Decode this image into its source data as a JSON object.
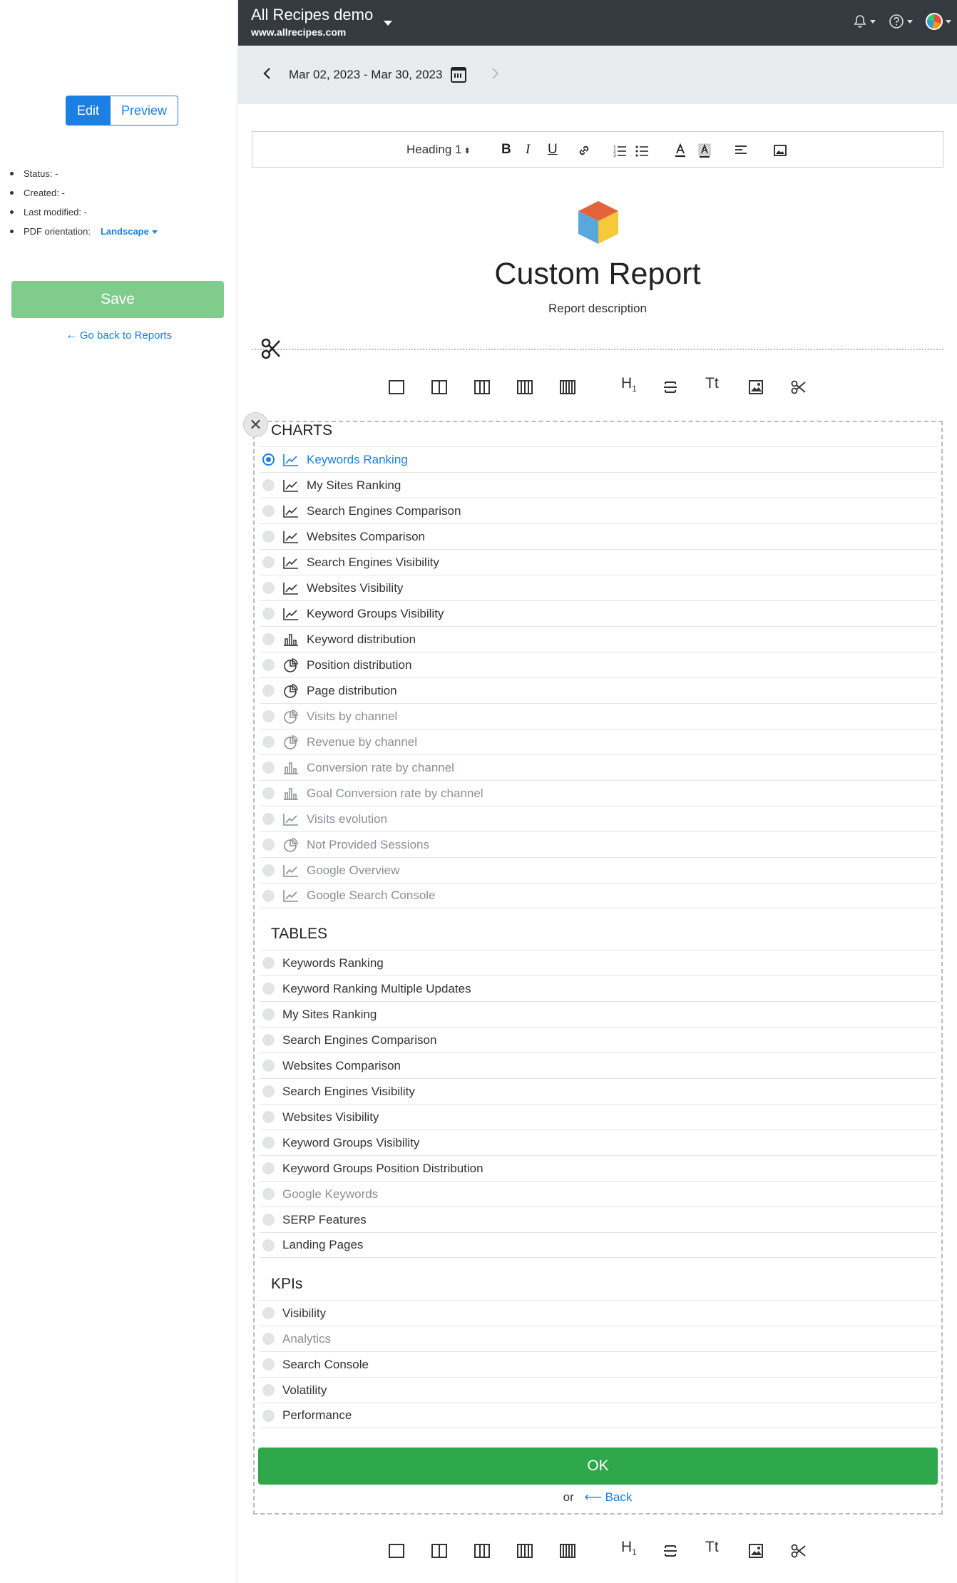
{
  "sidebar": {
    "mode_edit": "Edit",
    "mode_preview": "Preview",
    "status_label": "Status:",
    "status_value": "-",
    "created_label": "Created:",
    "created_value": "-",
    "modified_label": "Last modified:",
    "modified_value": "-",
    "orientation_label": "PDF orientation:",
    "orientation_value": "Landscape",
    "save_label": "Save",
    "back_label": "Go back to Reports"
  },
  "topbar": {
    "title": "All Recipes demo",
    "subtitle": "www.allrecipes.com",
    "icons": [
      "bell-icon",
      "help-icon",
      "avatar"
    ]
  },
  "datebar": {
    "range": "Mar 02, 2023 - Mar 30, 2023"
  },
  "editor_toolbar": {
    "heading": "Heading 1"
  },
  "report": {
    "title": "Custom Report",
    "description": "Report description"
  },
  "block_bar": {
    "heading_glyph": "H",
    "heading_sub": "1",
    "text_glyph": "Tt"
  },
  "panel": {
    "charts_title": "CHARTS",
    "charts": [
      {
        "label": "Keywords Ranking",
        "icon": "line",
        "state": "selected"
      },
      {
        "label": "My Sites Ranking",
        "icon": "line",
        "state": "normal"
      },
      {
        "label": "Search Engines Comparison",
        "icon": "line",
        "state": "normal"
      },
      {
        "label": "Websites Comparison",
        "icon": "line",
        "state": "normal"
      },
      {
        "label": "Search Engines Visibility",
        "icon": "line",
        "state": "normal"
      },
      {
        "label": "Websites Visibility",
        "icon": "line",
        "state": "normal"
      },
      {
        "label": "Keyword Groups Visibility",
        "icon": "line",
        "state": "normal"
      },
      {
        "label": "Keyword distribution",
        "icon": "bar",
        "state": "normal"
      },
      {
        "label": "Position distribution",
        "icon": "pie",
        "state": "normal"
      },
      {
        "label": "Page distribution",
        "icon": "pie",
        "state": "normal"
      },
      {
        "label": "Visits by channel",
        "icon": "pie",
        "state": "disabled"
      },
      {
        "label": "Revenue by channel",
        "icon": "pie",
        "state": "disabled"
      },
      {
        "label": "Conversion rate by channel",
        "icon": "bar",
        "state": "disabled"
      },
      {
        "label": "Goal Conversion rate by channel",
        "icon": "bar",
        "state": "disabled"
      },
      {
        "label": "Visits evolution",
        "icon": "line",
        "state": "disabled"
      },
      {
        "label": "Not Provided Sessions",
        "icon": "pie",
        "state": "disabled"
      },
      {
        "label": "Google Overview",
        "icon": "line",
        "state": "disabled"
      },
      {
        "label": "Google Search Console",
        "icon": "line",
        "state": "disabled"
      }
    ],
    "tables_title": "TABLES",
    "tables": [
      {
        "label": "Keywords Ranking",
        "state": "normal"
      },
      {
        "label": "Keyword Ranking Multiple Updates",
        "state": "normal"
      },
      {
        "label": "My Sites Ranking",
        "state": "normal"
      },
      {
        "label": "Search Engines Comparison",
        "state": "normal"
      },
      {
        "label": "Websites Comparison",
        "state": "normal"
      },
      {
        "label": "Search Engines Visibility",
        "state": "normal"
      },
      {
        "label": "Websites Visibility",
        "state": "normal"
      },
      {
        "label": "Keyword Groups Visibility",
        "state": "normal"
      },
      {
        "label": "Keyword Groups Position Distribution",
        "state": "normal"
      },
      {
        "label": "Google Keywords",
        "state": "disabled"
      },
      {
        "label": "SERP Features",
        "state": "normal"
      },
      {
        "label": "Landing Pages",
        "state": "normal"
      }
    ],
    "kpis_title": "KPIs",
    "kpis": [
      {
        "label": "Visibility",
        "state": "normal"
      },
      {
        "label": "Analytics",
        "state": "disabled"
      },
      {
        "label": "Search Console",
        "state": "normal"
      },
      {
        "label": "Volatility",
        "state": "normal"
      },
      {
        "label": "Performance",
        "state": "normal"
      }
    ],
    "ok_label": "OK",
    "or_label": "or",
    "back_label": "Back"
  },
  "colors": {
    "accent": "#1b7fe3",
    "ok": "#2ea84b",
    "save": "#7fcc8c",
    "topbar": "#343a40"
  }
}
